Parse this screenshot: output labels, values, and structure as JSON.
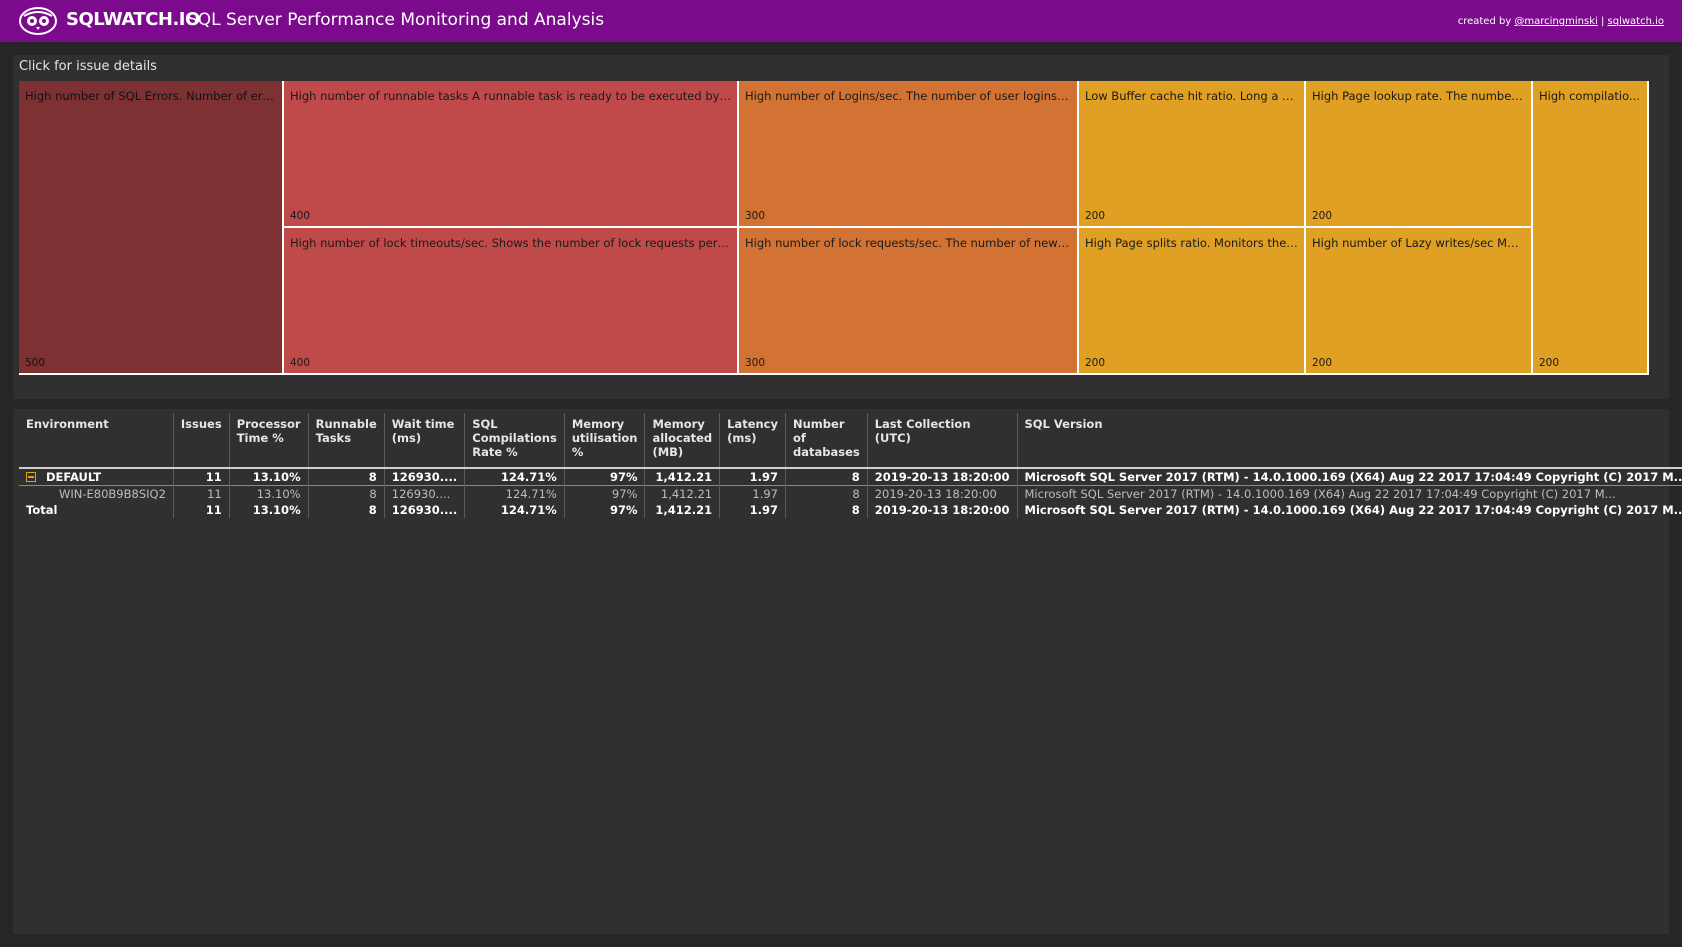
{
  "header": {
    "brand": "SQLWATCH.IO",
    "subtitle": "SQL Server Performance Monitoring and Analysis",
    "credits_prefix": "created by ",
    "credits_author": "@marcingminski",
    "credits_sep": " | ",
    "credits_site": "sqlwatch.io"
  },
  "issues_panel": {
    "title": "Click for issue details",
    "tiles": [
      {
        "label": "High number of SQL Errors. Number of errors ...",
        "value": "500",
        "color": "#7d3132"
      },
      {
        "label": "High number of runnable tasks A runnable task is ready to be executed by th...",
        "value": "400",
        "color": "#c04a4a"
      },
      {
        "label": "High number of lock timeouts/sec. Shows the number of lock requests per se...",
        "value": "400",
        "color": "#c04a4a"
      },
      {
        "label": "High number of Logins/sec. The number of user logins p...",
        "value": "300",
        "color": "#d37333"
      },
      {
        "label": "High number of lock requests/sec. The number of new lo...",
        "value": "300",
        "color": "#d37333"
      },
      {
        "label": "Low Buffer cache hit ratio. Long a st...",
        "value": "200",
        "color": "#e0a023"
      },
      {
        "label": "High Page splits ratio. Monitors the n...",
        "value": "200",
        "color": "#e0a023"
      },
      {
        "label": "High Page lookup rate. The number o...",
        "value": "200",
        "color": "#e0a023"
      },
      {
        "label": "High number of Lazy writes/sec Mon...",
        "value": "200",
        "color": "#e0a023"
      },
      {
        "label": "High compilatio...",
        "value": "200",
        "color": "#e0a023"
      }
    ]
  },
  "table": {
    "headers": [
      "Environment",
      "Issues",
      "Processor Time %",
      "Runnable Tasks",
      "Wait time (ms)",
      "SQL Compilations Rate %",
      "Memory utilisation %",
      "Memory allocated (MB)",
      "Latency (ms)",
      "Number of databases",
      "Last Collection (UTC)",
      "SQL Version"
    ],
    "group": {
      "name": "DEFAULT",
      "cells": [
        "11",
        "13.10%",
        "8",
        "126930....",
        "124.71%",
        "97%",
        "1,412.21",
        "1.97",
        "8",
        "2019-20-13 18:20:00",
        "Microsoft SQL Server 2017 (RTM) - 14.0.1000.169 (X64)  Aug 22 2017 17:04:49  Copyright (C) 2017 M..."
      ]
    },
    "child": {
      "name": "WIN-E80B9B8SIQ2",
      "cells": [
        "11",
        "13.10%",
        "8",
        "126930....",
        "124.71%",
        "97%",
        "1,412.21",
        "1.97",
        "8",
        "2019-20-13 18:20:00",
        "Microsoft SQL Server 2017 (RTM) - 14.0.1000.169 (X64)  Aug 22 2017 17:04:49  Copyright (C) 2017 M..."
      ]
    },
    "total": {
      "name": "Total",
      "cells": [
        "11",
        "13.10%",
        "8",
        "126930....",
        "124.71%",
        "97%",
        "1,412.21",
        "1.97",
        "8",
        "2019-20-13 18:20:00",
        "Microsoft SQL Server 2017 (RTM) - 14.0.1000.169 (X64)  Aug 22 2017 17:04:49  Copyright (C) 2017 M..."
      ]
    }
  },
  "colors": {
    "header_bg": "#7b0a8d",
    "page_bg": "#262626",
    "panel_bg": "#303030"
  }
}
